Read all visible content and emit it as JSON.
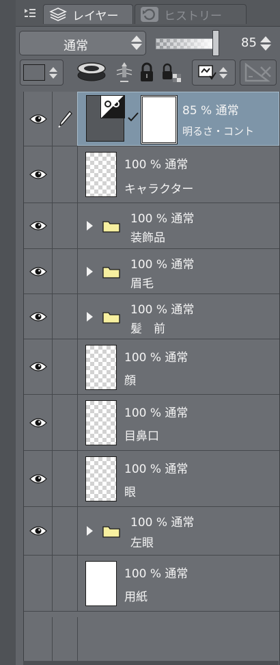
{
  "tabs": {
    "menu_icon": "panel-menu-icon",
    "active": {
      "icon": "layers-icon",
      "label": "レイヤー"
    },
    "inactive": {
      "icon": "history-icon",
      "label": "ヒストリー"
    }
  },
  "toolbar": {
    "blend_mode": "通常",
    "opacity": "85",
    "opacity_fraction": 0.85,
    "row2_icons": [
      "palette-color-icon",
      "clip-mask-icon",
      "reference-layer-icon",
      "lock-icon",
      "lock-transparent-icon",
      "layer-mask-icon",
      "ruler-delete-icon"
    ]
  },
  "colors": {
    "panel_bg": "#62656a",
    "list_bg": "#6b6e73",
    "selected_bg": "#7e95a8",
    "folder_yellow": "#f7f0a0"
  },
  "layers": [
    {
      "opacity_mode": "85 % 通常",
      "name": "明るさ・コント",
      "visible": true,
      "editing": true,
      "selected": true,
      "type": "correction"
    },
    {
      "opacity_mode": "100 % 通常",
      "name": "キャラクター",
      "visible": true,
      "type": "raster"
    },
    {
      "opacity_mode": "100 % 通常",
      "name": "装飾品",
      "visible": true,
      "type": "folder"
    },
    {
      "opacity_mode": "100 % 通常",
      "name": "眉毛",
      "visible": true,
      "type": "folder"
    },
    {
      "opacity_mode": "100 % 通常",
      "name": "髪　前",
      "visible": true,
      "type": "folder"
    },
    {
      "opacity_mode": "100 % 通常",
      "name": "顔",
      "visible": true,
      "type": "raster"
    },
    {
      "opacity_mode": "100 % 通常",
      "name": "目鼻口",
      "visible": true,
      "type": "raster"
    },
    {
      "opacity_mode": "100 % 通常",
      "name": "眼",
      "visible": true,
      "type": "raster"
    },
    {
      "opacity_mode": "100 % 通常",
      "name": "左眼",
      "visible": true,
      "type": "folder"
    },
    {
      "opacity_mode": "100 % 通常",
      "name": "用紙",
      "visible": false,
      "type": "paper"
    }
  ]
}
